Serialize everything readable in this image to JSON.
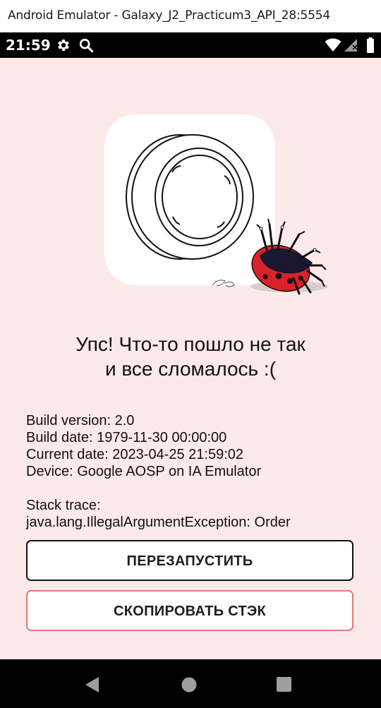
{
  "window": {
    "title": "Android Emulator - Galaxy_J2_Practicum3_API_28:5554"
  },
  "status_bar": {
    "time": "21:59"
  },
  "error": {
    "heading_line1": "Упс! Что-то пошло не так",
    "heading_line2": "и все сломалось :("
  },
  "info": {
    "build_version": "Build version: 2.0",
    "build_date": "Build date: 1979-11-30 00:00:00",
    "current_date": "Current date: 2023-04-25 21:59:02",
    "device": "Device: Google AOSP on IA Emulator",
    "stack_trace_label": "Stack trace:",
    "stack_trace": "java.lang.IllegalArgumentException: Order"
  },
  "buttons": {
    "restart": "ПЕРЕЗАПУСТИТЬ",
    "copy_stack": "СКОПИРОВАТЬ СТЭК"
  },
  "colors": {
    "background": "#fbeae9",
    "copy_border": "#e27a7d",
    "ladybug_red": "#d8232a"
  }
}
